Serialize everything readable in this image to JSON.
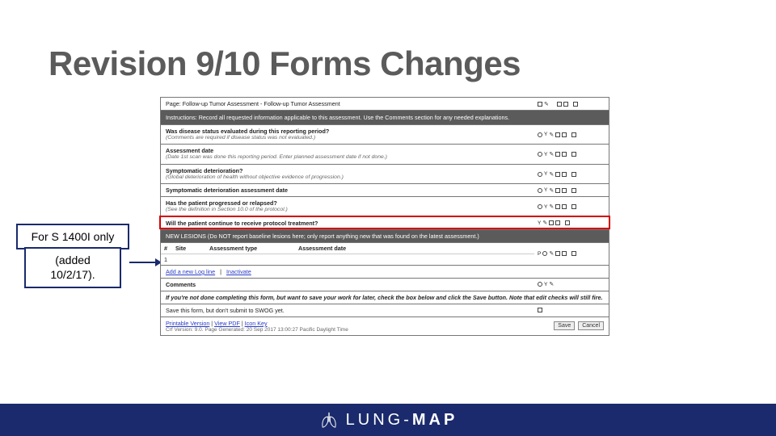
{
  "title": "Revision 9/10 Forms Changes",
  "callout": {
    "line1": "For S 1400I only",
    "line2": "(added 10/2/17)."
  },
  "form": {
    "page_header": "Page: Follow-up Tumor Assessment - Follow-up Tumor Assessment",
    "instructions": "Instructions: Record all requested information applicable to this assessment. Use the Comments section for any needed explanations.",
    "q1": {
      "label": "Was disease status evaluated during this reporting period?",
      "sub": "(Comments are required if disease status was not evaluated.)"
    },
    "q2": {
      "label": "Assessment date",
      "sub": "(Date 1st scan was done this reporting period. Enter planned assessment date if not done.)"
    },
    "q3": {
      "label": "Symptomatic deterioration?",
      "sub": "(Global deterioration of health without objective evidence of progression.)"
    },
    "q4": {
      "label": "Symptomatic deterioration assessment date"
    },
    "q5": {
      "label": "Has the patient progressed or relapsed?",
      "sub": "(See the definition in Section 10.0 of the protocol.)"
    },
    "q6": {
      "label": "Will the patient continue to receive protocol treatment?"
    },
    "newlesions_header": "NEW LESIONS  (Do NOT report baseline lesions here; only report anything new that was found on the latest assessment.)",
    "table": {
      "h0": "#",
      "h1": "Site",
      "h2": "Assessment type",
      "h3": "Assessment date",
      "r1": "1",
      "add": "Add a new Log line"
    },
    "inactivate": "Inactivate",
    "comments": "Comments",
    "save_note": "If you're not done completing this form, but want to save your work for later, check the box below and click the Save button. Note that edit checks will still fire.",
    "save_partial": "Save this form, but don't submit to SWOG yet.",
    "links": {
      "printable": "Printable Version",
      "pdf": "View PDF",
      "icon": "Icon Key"
    },
    "crf_meta": "Crf Version: 9.0. Page Generated: 20 Sep 2017 13:00:27 Pacific Daylight Time",
    "save_btn": "Save",
    "cancel_btn": "Cancel"
  },
  "footer": {
    "brand1": "LUNG-",
    "brand2": "MAP"
  }
}
